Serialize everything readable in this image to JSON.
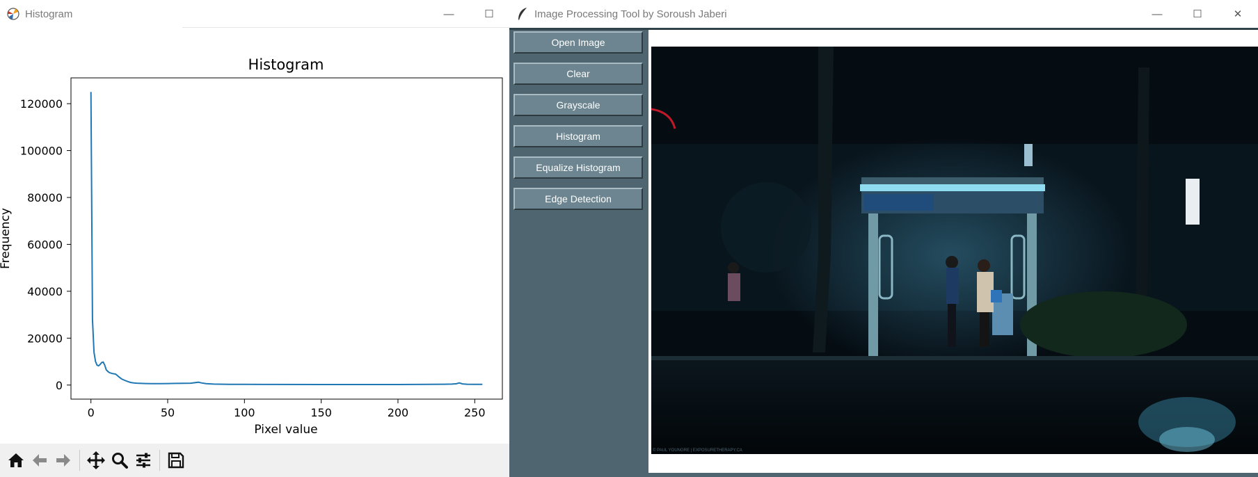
{
  "histogram_window": {
    "title": "Histogram",
    "controls": {
      "minimize": "—",
      "maximize": "☐"
    },
    "toolbar": [
      "home-icon",
      "back-icon",
      "forward-icon",
      "pan-icon",
      "zoom-icon",
      "configure-icon",
      "save-icon"
    ]
  },
  "chart_data": {
    "type": "line",
    "title": "Histogram",
    "xlabel": "Pixel value",
    "ylabel": "Frequency",
    "xlim": [
      -13,
      268
    ],
    "ylim": [
      -6000,
      131000
    ],
    "xticks": [
      0,
      50,
      100,
      150,
      200,
      250
    ],
    "yticks": [
      0,
      20000,
      40000,
      60000,
      80000,
      100000,
      120000
    ],
    "line_color": "#1f77b4",
    "series": [
      {
        "x": [
          0,
          1,
          2,
          3,
          4,
          5,
          6,
          7,
          8,
          9,
          10,
          11,
          12,
          13,
          14,
          15,
          16,
          17,
          18,
          19,
          20,
          22,
          24,
          26,
          28,
          30,
          33,
          36,
          40,
          45,
          50,
          55,
          60,
          65,
          70,
          72,
          75,
          80,
          90,
          100,
          120,
          150,
          180,
          200,
          220,
          230,
          235,
          238,
          240,
          242,
          245,
          250,
          255
        ],
        "y": [
          125000,
          28000,
          14000,
          10000,
          8500,
          8200,
          8800,
          9600,
          9800,
          8500,
          6500,
          5800,
          5300,
          5100,
          4900,
          4800,
          4700,
          4200,
          3600,
          3100,
          2600,
          2000,
          1500,
          1100,
          900,
          800,
          700,
          650,
          600,
          620,
          650,
          700,
          750,
          800,
          1200,
          900,
          600,
          400,
          300,
          280,
          260,
          240,
          220,
          230,
          300,
          350,
          400,
          550,
          900,
          500,
          350,
          300,
          280
        ]
      }
    ]
  },
  "ip_window": {
    "title": "Image Processing Tool by Soroush Jaberi",
    "controls": {
      "minimize": "—",
      "maximize": "☐",
      "close": "✕"
    },
    "buttons": [
      "Open Image",
      "Clear",
      "Grayscale",
      "Histogram",
      "Equalize Histogram",
      "Edge Detection"
    ],
    "photo_credit": "© PAUL YOUNGRE | EXPOSURETHERAPY.CA"
  }
}
